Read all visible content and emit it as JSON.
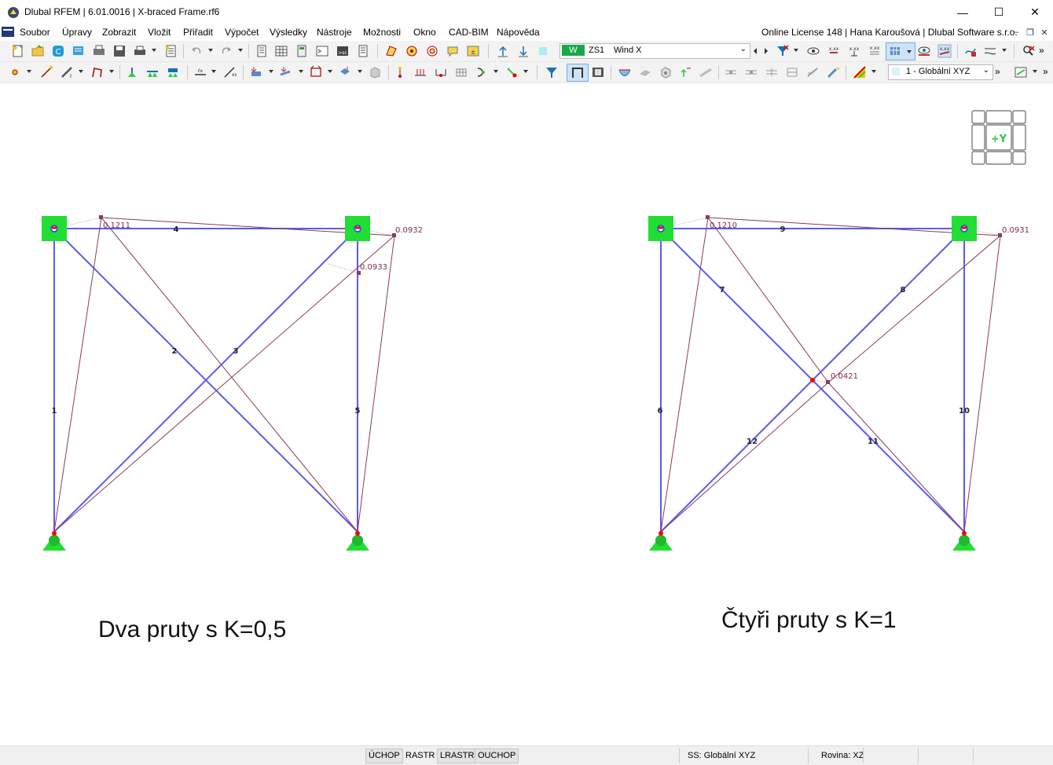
{
  "window": {
    "title": "Dlubal RFEM | 6.01.0016 | X-braced Frame.rf6",
    "minimize": "—",
    "maximize": "☐",
    "close": "✕"
  },
  "menu": {
    "items": [
      "Soubor",
      "Úpravy",
      "Zobrazit",
      "Vložit",
      "Přiřadit",
      "Výpočet",
      "Výsledky",
      "Nástroje",
      "Možnosti",
      "Okno",
      "CAD-BIM",
      "Nápověda"
    ],
    "license": "Online License 148 | Hana Karoušová | Dlubal Software s.r.o."
  },
  "toolbar": {
    "load_tag": "W",
    "load_case": "ZS1",
    "load_name": "Wind X",
    "coord_system": "1 - Globální XYZ",
    "overflow": "»"
  },
  "viewcube": {
    "label": "+Y"
  },
  "model": {
    "left": {
      "member_labels": [
        "1",
        "2",
        "3",
        "4",
        "5"
      ],
      "deformation_labels": [
        "0.1211",
        "0.0932",
        "0.0933"
      ],
      "caption": "Dva pruty s K=0,5"
    },
    "right": {
      "member_labels": [
        "6",
        "7",
        "8",
        "9",
        "10",
        "11",
        "12"
      ],
      "deformation_labels": [
        "0.1210",
        "0.0931",
        "0.0421"
      ],
      "caption": "Čtyři pruty s K=1"
    },
    "colors": {
      "member": "#5a5af0",
      "deformed": "#8a3a5a",
      "support": "#2ecc40",
      "node": "#ff0000"
    }
  },
  "statusbar": {
    "toggles": [
      "ÚCHOP",
      "RASTR",
      "LRASTR",
      "OUCHOP"
    ],
    "cs": "SS: Globální XYZ",
    "plane": "Rovina: XZ"
  }
}
